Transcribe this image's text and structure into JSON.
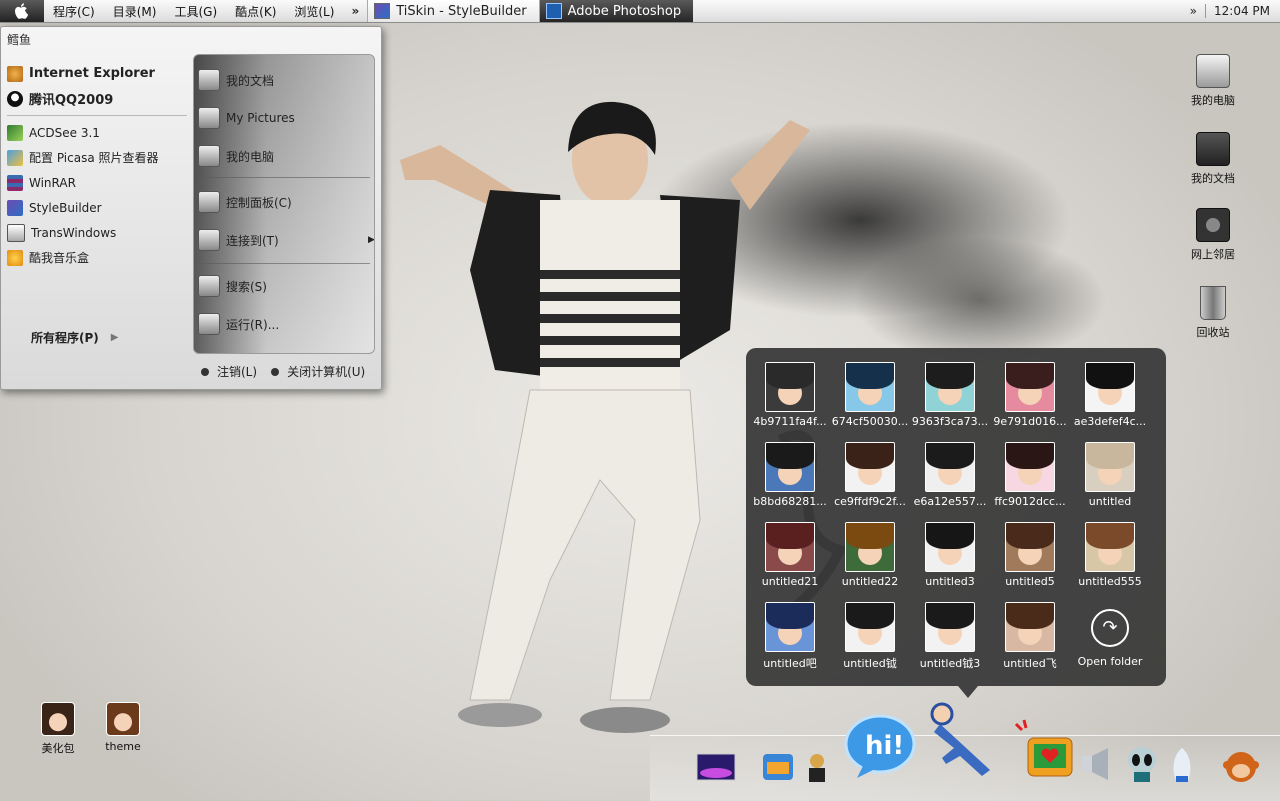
{
  "menubar": {
    "menus": [
      "程序(C)",
      "目录(M)",
      "工具(G)",
      "酷点(K)",
      "浏览(L)"
    ],
    "overflow": "»",
    "tasks": [
      {
        "title": "TiSkin - StyleBuilder",
        "active": false
      },
      {
        "title": "Adobe Photoshop",
        "active": true
      }
    ],
    "clock": "12:04 PM"
  },
  "start_menu": {
    "user": "鳕鱼",
    "pinned": [
      {
        "label": "Internet Explorer",
        "icon": "internet-explorer-icon"
      },
      {
        "label": "腾讯QQ2009",
        "icon": "qq-penguin-icon"
      }
    ],
    "programs": [
      {
        "label": "ACDSee 3.1",
        "icon": "acdsee-icon"
      },
      {
        "label": "配置 Picasa 照片查看器",
        "icon": "picasa-icon"
      },
      {
        "label": "WinRAR",
        "icon": "winrar-icon"
      },
      {
        "label": "StyleBuilder",
        "icon": "stylebuilder-icon"
      },
      {
        "label": "TransWindows",
        "icon": "transwindows-icon"
      },
      {
        "label": "酷我音乐盒",
        "icon": "kuwo-music-icon"
      }
    ],
    "all_programs": "所有程序(P)",
    "places": [
      {
        "label": "我的文档",
        "icon": "my-documents-icon"
      },
      {
        "label": "My Pictures",
        "icon": "my-pictures-icon"
      },
      {
        "label": "我的电脑",
        "icon": "my-computer-icon"
      },
      {
        "label": "控制面板(C)",
        "icon": "control-panel-icon"
      },
      {
        "label": "连接到(T)",
        "icon": "connect-to-icon",
        "submenu": true
      },
      {
        "label": "搜索(S)",
        "icon": "search-icon"
      },
      {
        "label": "运行(R)...",
        "icon": "run-icon"
      }
    ],
    "logoff": "注销(L)",
    "shutdown": "关闭计算机(U)"
  },
  "desktop_icons": {
    "my_computer": "我的电脑",
    "my_documents": "我的文档",
    "network": "网上邻居",
    "recycle_bin": "回收站",
    "beautify": "美化包",
    "theme": "theme"
  },
  "stack": {
    "items": [
      {
        "label": "4b9711fa4f...",
        "hair": "#2a2a2a",
        "bg": "#3b3b3b"
      },
      {
        "label": "674cf50030...",
        "hair": "#14304a",
        "bg": "#87c8e8"
      },
      {
        "label": "9363f3ca73...",
        "hair": "#1d1d1d",
        "bg": "#8fd3d6"
      },
      {
        "label": "9e791d016...",
        "hair": "#3a1e1e",
        "bg": "#e68aa0"
      },
      {
        "label": "ae3defef4c...",
        "hair": "#111111",
        "bg": "#f4f4f4"
      },
      {
        "label": "b8bd68281...",
        "hair": "#1a1a1a",
        "bg": "#4a78b8"
      },
      {
        "label": "ce9ffdf9c2f...",
        "hair": "#3b2218",
        "bg": "#f2f2f2"
      },
      {
        "label": "e6a12e557...",
        "hair": "#1b1b1b",
        "bg": "#efefef"
      },
      {
        "label": "ffc9012dcc...",
        "hair": "#2b1616",
        "bg": "#f6d7e2"
      },
      {
        "label": "untitled",
        "hair": "#c8b79d",
        "bg": "#d9cfc1"
      },
      {
        "label": "untitled21",
        "hair": "#5a2020",
        "bg": "#8a4a4a"
      },
      {
        "label": "untitled22",
        "hair": "#7a4a10",
        "bg": "#3e6b3a"
      },
      {
        "label": "untitled3",
        "hair": "#161616",
        "bg": "#f0f0f0"
      },
      {
        "label": "untitled5",
        "hair": "#4a2a1a",
        "bg": "#a07a5a"
      },
      {
        "label": "untitled555",
        "hair": "#7a4a2a",
        "bg": "#d8c7a7"
      },
      {
        "label": "untitled吧",
        "hair": "#1b2c5a",
        "bg": "#6a94d8"
      },
      {
        "label": "untitled钺",
        "hair": "#1a1a1a",
        "bg": "#f2f2f2"
      },
      {
        "label": "untitled钺3",
        "hair": "#1a1a1a",
        "bg": "#f2f2f2"
      },
      {
        "label": "untitled飞",
        "hair": "#4a2b1a",
        "bg": "#d8b7a3"
      }
    ],
    "open_folder": "Open folder"
  },
  "dock": {
    "items": [
      "screen-app-icon",
      "mail-app-icon",
      "cartoon-figure-icon",
      "hi-bubble-icon",
      "dancing-figure-icon",
      "tv-heart-icon",
      "speaker-icon",
      "alien-icon",
      "rocket-icon",
      "monkey-icon"
    ]
  },
  "colors": {
    "menubar_active": "#2b2b2b",
    "stack_bg": "#373737",
    "wallpaper": "#dedbd6"
  }
}
